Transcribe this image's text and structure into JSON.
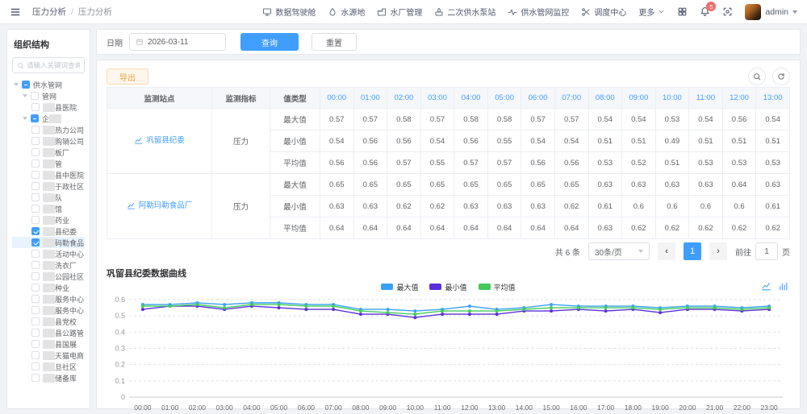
{
  "header": {
    "breadcrumb_1": "压力分析",
    "breadcrumb_sep": "/",
    "breadcrumb_2": "压力分析",
    "nav_items": [
      {
        "label": "数据驾驶舱",
        "icon": "monitor-icon"
      },
      {
        "label": "水源地",
        "icon": "water-drop-icon"
      },
      {
        "label": "水厂管理",
        "icon": "factory-icon"
      },
      {
        "label": "二次供水泵站",
        "icon": "pump-icon"
      },
      {
        "label": "供水管网监控",
        "icon": "pulse-icon"
      },
      {
        "label": "调度中心",
        "icon": "dispatch-icon"
      },
      {
        "label": "更多",
        "icon": "chevron-down-icon"
      }
    ],
    "notification_count": "5",
    "username": "admin"
  },
  "sidebar": {
    "title": "组织结构",
    "search_placeholder": "请输入关键词查询",
    "tree": [
      {
        "label": "供水管网",
        "level": 0,
        "caret": true,
        "check": "indeterminate",
        "mask": "none"
      },
      {
        "label": "管网",
        "level": 1,
        "caret": true,
        "check": "unchecked",
        "mask": "none"
      },
      {
        "label": "县医院",
        "level": 2,
        "caret": false,
        "check": "unchecked",
        "mask": "prefix"
      },
      {
        "label": "企",
        "level": 1,
        "caret": true,
        "check": "indeterminate",
        "mask": "suffix"
      },
      {
        "label": "热力公司",
        "level": 2,
        "caret": false,
        "check": "unchecked",
        "mask": "prefix"
      },
      {
        "label": "购销公司",
        "level": 2,
        "caret": false,
        "check": "unchecked",
        "mask": "prefix"
      },
      {
        "label": "板厂",
        "level": 2,
        "caret": false,
        "check": "unchecked",
        "mask": "prefix"
      },
      {
        "label": "管",
        "level": 2,
        "caret": false,
        "check": "unchecked",
        "mask": "prefix"
      },
      {
        "label": "县中医院",
        "level": 2,
        "caret": false,
        "check": "unchecked",
        "mask": "prefix"
      },
      {
        "label": "于政社区",
        "level": 2,
        "caret": false,
        "check": "unchecked",
        "mask": "prefix"
      },
      {
        "label": "队",
        "level": 2,
        "caret": false,
        "check": "unchecked",
        "mask": "prefix"
      },
      {
        "label": "馆",
        "level": 2,
        "caret": false,
        "check": "unchecked",
        "mask": "prefix"
      },
      {
        "label": "药业",
        "level": 2,
        "caret": false,
        "check": "unchecked",
        "mask": "prefix"
      },
      {
        "label": "县纪委",
        "level": 2,
        "caret": false,
        "check": "checked",
        "mask": "prefix"
      },
      {
        "label": "码勒食品",
        "level": 2,
        "caret": false,
        "check": "checked",
        "mask": "prefix",
        "highlight": true
      },
      {
        "label": "活动中心",
        "level": 2,
        "caret": false,
        "check": "unchecked",
        "mask": "prefix"
      },
      {
        "label": "洗衣厂",
        "level": 2,
        "caret": false,
        "check": "unchecked",
        "mask": "prefix"
      },
      {
        "label": "公园社区",
        "level": 2,
        "caret": false,
        "check": "unchecked",
        "mask": "prefix"
      },
      {
        "label": "种业",
        "level": 2,
        "caret": false,
        "check": "unchecked",
        "mask": "prefix"
      },
      {
        "label": "服务中心",
        "level": 2,
        "caret": false,
        "check": "unchecked",
        "mask": "prefix"
      },
      {
        "label": "服务中心",
        "level": 2,
        "caret": false,
        "check": "unchecked",
        "mask": "prefix"
      },
      {
        "label": "县党校",
        "level": 2,
        "caret": false,
        "check": "unchecked",
        "mask": "prefix"
      },
      {
        "label": "县公路管",
        "level": 2,
        "caret": false,
        "check": "unchecked",
        "mask": "prefix"
      },
      {
        "label": "县国展",
        "level": 2,
        "caret": false,
        "check": "unchecked",
        "mask": "prefix"
      },
      {
        "label": "天猫电商",
        "level": 2,
        "caret": false,
        "check": "unchecked",
        "mask": "prefix"
      },
      {
        "label": "旦社区",
        "level": 2,
        "caret": false,
        "check": "unchecked",
        "mask": "prefix"
      },
      {
        "label": "储备库",
        "level": 2,
        "caret": false,
        "check": "unchecked",
        "mask": "prefix"
      }
    ]
  },
  "query": {
    "date_label": "日期",
    "date_value": "2026-03-11",
    "search_button": "查询",
    "reset_button": "重置"
  },
  "table": {
    "export_button": "导出",
    "fixed_headers": [
      "监测站点",
      "监测指标",
      "值类型"
    ],
    "time_headers": [
      "00:00",
      "01:00",
      "02:00",
      "03:00",
      "04:00",
      "05:00",
      "06:00",
      "07:00",
      "08:00",
      "09:00",
      "10:00",
      "11:00",
      "12:00",
      "13:00"
    ],
    "groups": [
      {
        "station": "巩留县纪委",
        "indicator": "压力",
        "rows": [
          {
            "type": "最大值",
            "values": [
              "0.57",
              "0.57",
              "0.58",
              "0.57",
              "0.58",
              "0.58",
              "0.57",
              "0.57",
              "0.54",
              "0.54",
              "0.53",
              "0.54",
              "0.56",
              "0.54"
            ]
          },
          {
            "type": "最小值",
            "values": [
              "0.54",
              "0.56",
              "0.56",
              "0.54",
              "0.56",
              "0.55",
              "0.54",
              "0.54",
              "0.51",
              "0.51",
              "0.49",
              "0.51",
              "0.51",
              "0.51"
            ]
          },
          {
            "type": "平均值",
            "values": [
              "0.56",
              "0.56",
              "0.57",
              "0.55",
              "0.57",
              "0.57",
              "0.56",
              "0.56",
              "0.53",
              "0.52",
              "0.51",
              "0.53",
              "0.53",
              "0.53"
            ]
          }
        ]
      },
      {
        "station": "阿勒玛勒食品厂",
        "indicator": "压力",
        "rows": [
          {
            "type": "最大值",
            "values": [
              "0.65",
              "0.65",
              "0.65",
              "0.65",
              "0.65",
              "0.65",
              "0.65",
              "0.65",
              "0.63",
              "0.63",
              "0.63",
              "0.63",
              "0.64",
              "0.63"
            ]
          },
          {
            "type": "最小值",
            "values": [
              "0.63",
              "0.63",
              "0.62",
              "0.62",
              "0.63",
              "0.63",
              "0.63",
              "0.62",
              "0.61",
              "0.6",
              "0.6",
              "0.6",
              "0.6",
              "0.61"
            ]
          },
          {
            "type": "平均值",
            "values": [
              "0.64",
              "0.64",
              "0.64",
              "0.64",
              "0.64",
              "0.64",
              "0.64",
              "0.64",
              "0.63",
              "0.62",
              "0.62",
              "0.62",
              "0.62",
              "0.62"
            ]
          }
        ]
      }
    ]
  },
  "pagination": {
    "total": "共 6 条",
    "page_size": "30条/页",
    "prev": "‹",
    "current_page": "1",
    "next": "›",
    "goto_label": "前往",
    "goto_value": "1",
    "page_label": "页"
  },
  "chart": {
    "title": "巩留县纪委数据曲线"
  },
  "chart_data": {
    "type": "line",
    "title": "巩留县纪委数据曲线",
    "x": [
      "00:00",
      "01:00",
      "02:00",
      "03:00",
      "04:00",
      "05:00",
      "06:00",
      "07:00",
      "08:00",
      "09:00",
      "10:00",
      "11:00",
      "12:00",
      "13:00",
      "14:00",
      "15:00",
      "16:00",
      "17:00",
      "18:00",
      "19:00",
      "20:00",
      "21:00",
      "22:00",
      "23:00"
    ],
    "series": [
      {
        "name": "最大值",
        "color": "#38a1f7",
        "values": [
          0.57,
          0.57,
          0.58,
          0.57,
          0.58,
          0.58,
          0.57,
          0.57,
          0.54,
          0.54,
          0.53,
          0.54,
          0.56,
          0.54,
          0.55,
          0.57,
          0.56,
          0.56,
          0.56,
          0.55,
          0.56,
          0.56,
          0.55,
          0.56
        ]
      },
      {
        "name": "最小值",
        "color": "#5a2fd8",
        "values": [
          0.54,
          0.56,
          0.56,
          0.54,
          0.56,
          0.55,
          0.54,
          0.54,
          0.51,
          0.51,
          0.49,
          0.51,
          0.51,
          0.51,
          0.53,
          0.53,
          0.54,
          0.53,
          0.54,
          0.52,
          0.54,
          0.54,
          0.53,
          0.54
        ]
      },
      {
        "name": "平均值",
        "color": "#43ca5a",
        "values": [
          0.56,
          0.56,
          0.57,
          0.55,
          0.57,
          0.57,
          0.56,
          0.56,
          0.53,
          0.52,
          0.51,
          0.53,
          0.53,
          0.53,
          0.54,
          0.55,
          0.55,
          0.55,
          0.55,
          0.54,
          0.55,
          0.55,
          0.54,
          0.55
        ]
      }
    ],
    "ylim": [
      0,
      0.6
    ],
    "yticks": [
      0,
      0.1,
      0.2,
      0.3,
      0.4,
      0.5,
      0.6
    ],
    "xlabel": "",
    "ylabel": "",
    "grid": "dashed-horizontal",
    "legend_position": "top-center"
  },
  "colors": {
    "accent": "#409eff",
    "warning": "#e6a23c",
    "badge": "#f56c6c"
  }
}
